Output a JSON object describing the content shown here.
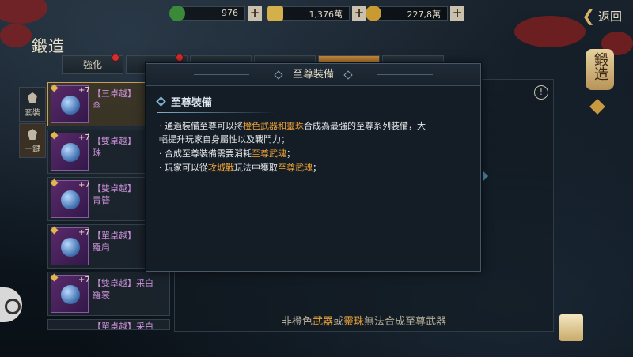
{
  "resources": [
    {
      "icon": "jade-icon",
      "value": "976",
      "color": "#3a8a3a"
    },
    {
      "icon": "gold-ingot-icon",
      "value": "1,376萬",
      "color": "#d4b04a"
    },
    {
      "icon": "coin-icon",
      "value": "227,8萬",
      "color": "#c89a30"
    }
  ],
  "back_label": "返回",
  "page_title": "鍛造",
  "tabs": [
    {
      "label": "強化",
      "dot": true
    },
    {
      "label": "",
      "dot": true
    },
    {
      "label": "",
      "dot": false
    },
    {
      "label": "",
      "dot": false
    },
    {
      "label": "",
      "dot": false,
      "active": true
    },
    {
      "label": "",
      "dot": false
    }
  ],
  "side_tabs": [
    {
      "label": "套裝"
    },
    {
      "label": "一鍵",
      "active": true
    }
  ],
  "items": [
    {
      "level": "+7",
      "name": "【三卓越】",
      "name2": "傘"
    },
    {
      "level": "+7",
      "name": "【雙卓越】",
      "name2": "珠"
    },
    {
      "level": "+7",
      "name": "【雙卓越】",
      "name2": "青簪"
    },
    {
      "level": "+7",
      "name": "【單卓越】",
      "name2": "羅肩"
    },
    {
      "level": "+7",
      "name": "【雙卓越】采白",
      "name2": "羅裳"
    },
    {
      "level": "+7",
      "name": "【單卓越】采白",
      "name2": ""
    }
  ],
  "badge_text": "鍛造",
  "notice": {
    "before": "非橙色",
    "h1": "武器",
    "mid": "或",
    "h2": "靈珠",
    "after": "無法合成至尊武器"
  },
  "modal": {
    "title": "至尊裝備",
    "subtitle": "至尊裝備",
    "line1_a": "· 通過裝備至尊可以將",
    "line1_b": "橙色武器和靈珠",
    "line1_c": "合成為最強的至尊系列裝備，大",
    "line1_d": "幅提升玩家自身屬性以及戰鬥力；",
    "line2_a": "· 合成至尊裝備需要消耗",
    "line2_b": "至尊武魂",
    "line2_c": "；",
    "line3_a": "· 玩家可以從",
    "line3_b": "攻城戰",
    "line3_c": "玩法中獲取",
    "line3_d": "至尊武魂",
    "line3_e": "；"
  }
}
